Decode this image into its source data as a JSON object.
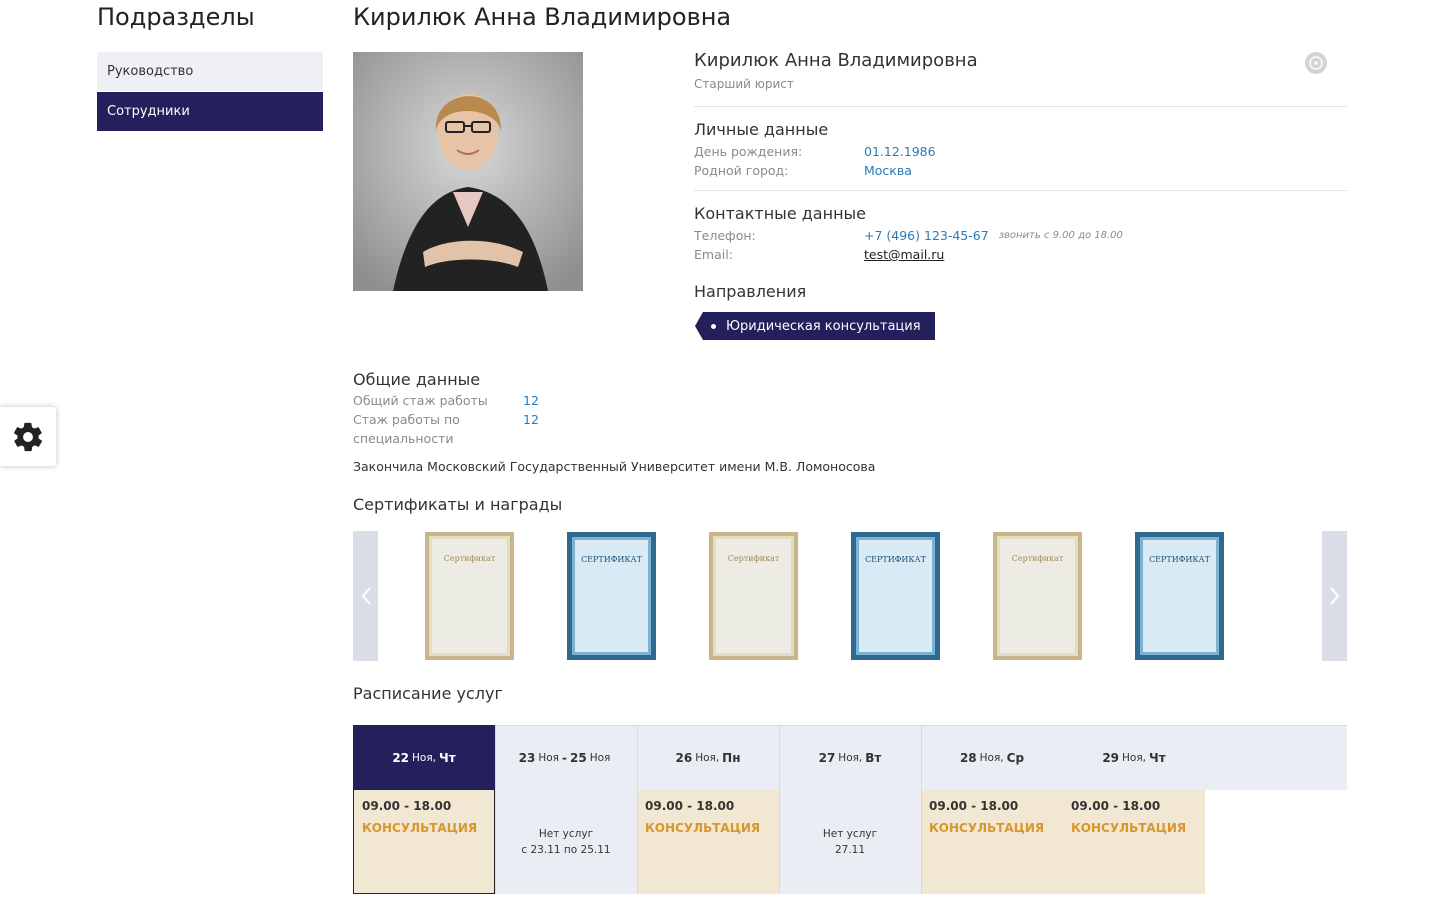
{
  "sidebar": {
    "title": "Подразделы",
    "items": [
      {
        "label": "Руководство",
        "active": false
      },
      {
        "label": "Сотрудники",
        "active": true
      }
    ]
  },
  "page": {
    "title": "Кирилюк Анна Владимировна"
  },
  "profile": {
    "name": "Кирилюк Анна Владимировна",
    "position": "Старший юрист",
    "personal": {
      "title": "Личные данные",
      "birthday_label": "День рождения:",
      "birthday": "01.12.1986",
      "hometown_label": "Родной город:",
      "hometown": "Москва"
    },
    "contacts": {
      "title": "Контактные данные",
      "phone_label": "Телефон:",
      "phone": "+7 (496) 123-45-67",
      "phone_note": "звонить с 9.00 до 18.00",
      "email_label": "Email:",
      "email": "test@mail.ru"
    },
    "directions": {
      "title": "Направления",
      "items": [
        "Юридическая консультация"
      ]
    }
  },
  "general": {
    "title": "Общие данные",
    "total_exp_label": "Общий стаж работы",
    "total_exp": "12",
    "spec_exp_label_1": "Стаж работы по",
    "spec_exp_label_2": "специальности",
    "spec_exp": "12",
    "education": "Закончила Московский Государственный Университет имени М.В. Ломоносова"
  },
  "certificates": {
    "title": "Сертификаты и награды",
    "items": [
      {
        "label": "Сертификат",
        "style": "gold"
      },
      {
        "label": "СЕРТИФИКАТ",
        "style": "blue"
      },
      {
        "label": "Сертификат",
        "style": "gold"
      },
      {
        "label": "СЕРТИФИКАТ",
        "style": "blue"
      },
      {
        "label": "Сертификат",
        "style": "gold"
      },
      {
        "label": "СЕРТИФИКАТ",
        "style": "blue"
      }
    ]
  },
  "schedule": {
    "title": "Расписание услуг",
    "days": [
      {
        "d1": "22",
        "m1": "Ноя,",
        "w1": "Чт",
        "d2": "",
        "m2": "",
        "active": true,
        "time": "09.00 - 18.00",
        "service": "КОНСУЛЬТАЦИЯ",
        "none1": "",
        "none2": ""
      },
      {
        "d1": "23",
        "m1": "Ноя",
        "w1": "-",
        "d2": "25",
        "m2": "Ноя",
        "active": false,
        "time": "",
        "service": "",
        "none1": "Нет услуг",
        "none2": "с 23.11 по 25.11"
      },
      {
        "d1": "26",
        "m1": "Ноя,",
        "w1": "Пн",
        "d2": "",
        "m2": "",
        "active": false,
        "time": "09.00 - 18.00",
        "service": "КОНСУЛЬТАЦИЯ",
        "none1": "",
        "none2": ""
      },
      {
        "d1": "27",
        "m1": "Ноя,",
        "w1": "Вт",
        "d2": "",
        "m2": "",
        "active": false,
        "time": "",
        "service": "",
        "none1": "Нет услуг",
        "none2": "27.11"
      },
      {
        "d1": "28",
        "m1": "Ноя,",
        "w1": "Ср",
        "d2": "",
        "m2": "",
        "active": false,
        "time": "09.00 - 18.00",
        "service": "КОНСУЛЬТАЦИЯ",
        "none1": "",
        "none2": ""
      },
      {
        "d1": "29",
        "m1": "Ноя,",
        "w1": "Чт",
        "d2": "",
        "m2": "",
        "active": false,
        "time": "09.00 - 18.00",
        "service": "КОНСУЛЬТАЦИЯ",
        "none1": "",
        "none2": ""
      }
    ]
  },
  "icons": {
    "settings": "gear-icon",
    "video": "play-icon",
    "prev": "chevron-left-icon",
    "next": "chevron-right-icon"
  },
  "colors": {
    "accent": "#23205c",
    "link": "#2b7bb8",
    "service": "#d9962b",
    "slot_bg": "#f2e7d2",
    "muted_bg": "#eaeef4"
  }
}
